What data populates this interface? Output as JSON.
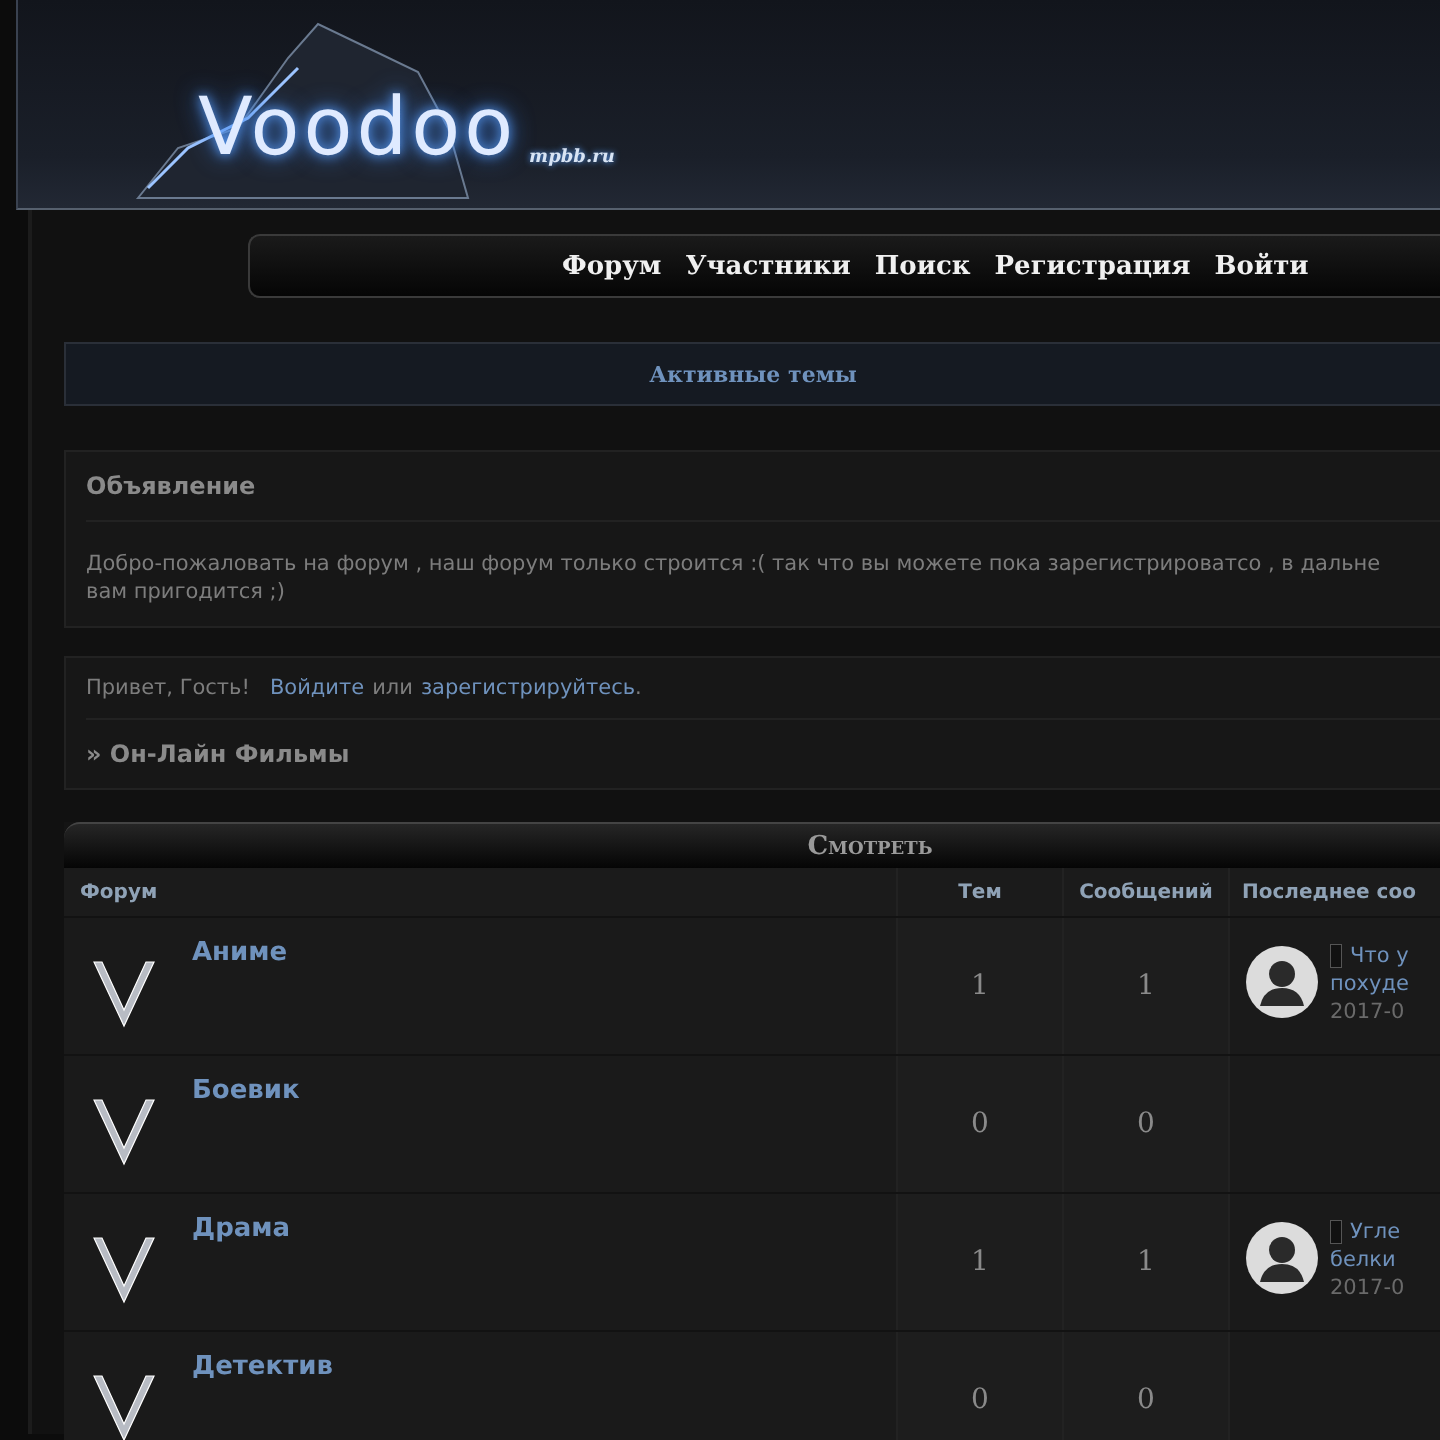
{
  "logo": {
    "title": "Voodoo",
    "domain": "mpbb.ru"
  },
  "nav": [
    "Форум",
    "Участники",
    "Поиск",
    "Регистрация",
    "Войти"
  ],
  "active_topics": "Активные темы",
  "announcement": {
    "title": "Объявление",
    "lines": [
      "Добро-пожаловать на форум , наш форум только строится :( так что вы можете пока зарегистрироватсо , в дальне",
      "вам пригодится ;)"
    ]
  },
  "welcome": {
    "greeting": "Привет, Гость!",
    "login": "Войдите",
    "or": "или",
    "register": "зарегистрируйтесь",
    "end": "."
  },
  "category": "» Он-Лайн Фильмы",
  "forum_table": {
    "title": "Смотреть",
    "columns": [
      "Форум",
      "Тем",
      "Сообщений",
      "Последнее соо"
    ],
    "rows": [
      {
        "name": "Аниме",
        "topics": "1",
        "posts": "1",
        "last_post": {
          "lines": [
            "Что у",
            "похуде"
          ],
          "date": "2017-0"
        }
      },
      {
        "name": "Боевик",
        "topics": "0",
        "posts": "0"
      },
      {
        "name": "Драма",
        "topics": "1",
        "posts": "1",
        "last_post": {
          "lines": [
            "Угле",
            "белки"
          ],
          "date": "2017-0"
        }
      },
      {
        "name": "Детектив",
        "topics": "0",
        "posts": "0"
      }
    ]
  }
}
